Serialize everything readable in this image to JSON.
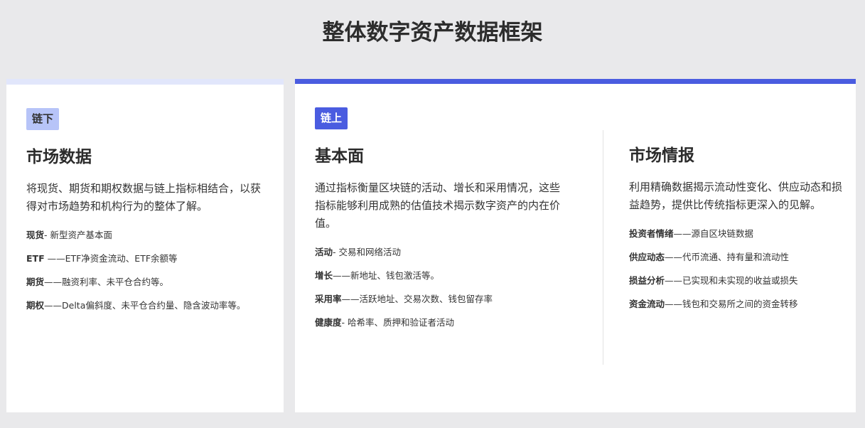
{
  "title": "整体数字资产数据框架",
  "offchain": {
    "badge": "链下",
    "heading": "市场数据",
    "desc": "将现货、期货和期权数据与链上指标相结合，以获得对市场趋势和机构行为的整体了解。",
    "items": [
      {
        "label": "现货",
        "text": "- 新型资产基本面"
      },
      {
        "label": "ETF",
        "text": " ——ETF净资金流动、ETF余额等"
      },
      {
        "label": "期货",
        "text": "——融资利率、未平仓合约等。"
      },
      {
        "label": "期权",
        "text": "——Delta偏斜度、未平仓合约量、隐含波动率等。"
      }
    ]
  },
  "onchain": {
    "badge": "链上",
    "fundamentals": {
      "heading": "基本面",
      "desc": "通过指标衡量区块链的活动、增长和采用情况，这些指标能够利用成熟的估值技术揭示数字资产的内在价值。",
      "items": [
        {
          "label": "活动",
          "text": "- 交易和网络活动"
        },
        {
          "label": "增长",
          "text": "——新地址、钱包激活等。"
        },
        {
          "label": "采用率",
          "text": "——活跃地址、交易次数、钱包留存率"
        },
        {
          "label": "健康度",
          "text": "- 哈希率、质押和验证者活动"
        }
      ]
    },
    "intelligence": {
      "heading": "市场情报",
      "desc": "利用精确数据揭示流动性变化、供应动态和损益趋势，提供比传统指标更深入的见解。",
      "items": [
        {
          "label": "投资者情绪",
          "text": "——源自区块链数据"
        },
        {
          "label": "供应动态",
          "text": "——代币流通、持有量和流动性"
        },
        {
          "label": "损益分析",
          "text": "——已实现和未实现的收益或损失"
        },
        {
          "label": "资金流动",
          "text": "——钱包和交易所之间的资金转移"
        }
      ]
    }
  }
}
